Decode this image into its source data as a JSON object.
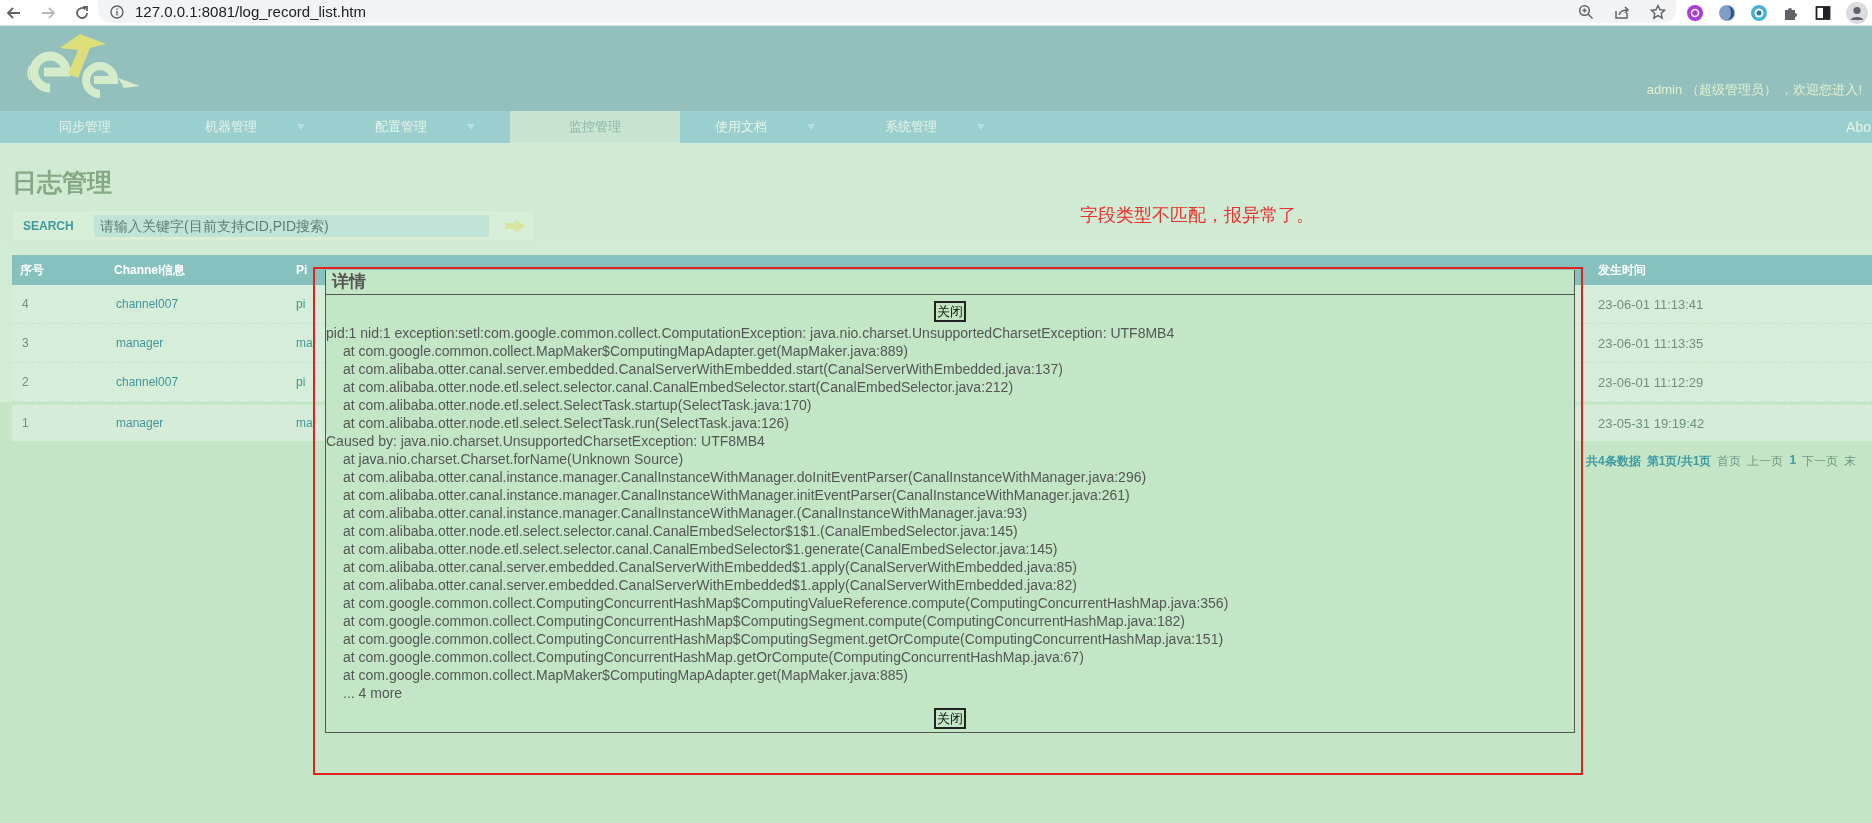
{
  "browser": {
    "url": "127.0.0.1:8081/log_record_list.htm"
  },
  "header": {
    "welcome": "admin （超级管理员） ，欢迎您进入!"
  },
  "nav": {
    "items": [
      {
        "label": "同步管理",
        "dropdown": false,
        "selected": false
      },
      {
        "label": "机器管理",
        "dropdown": true,
        "selected": false
      },
      {
        "label": "配置管理",
        "dropdown": true,
        "selected": false
      },
      {
        "label": "监控管理",
        "dropdown": false,
        "selected": true
      },
      {
        "label": "使用文档",
        "dropdown": true,
        "selected": false
      },
      {
        "label": "系统管理",
        "dropdown": true,
        "selected": false
      }
    ],
    "right_link": "Abo"
  },
  "page_title": "日志管理",
  "search": {
    "label": "SEARCH",
    "placeholder": "请输入关键字(目前支持CID,PID搜索)"
  },
  "table": {
    "columns": [
      "序号",
      "Channel信息",
      "Pi",
      "发生时间"
    ],
    "rows": [
      {
        "cells": [
          "4",
          "channel007",
          "pi",
          "23-06-01 11:13:41"
        ]
      },
      {
        "cells": [
          "3",
          "manager",
          "ma",
          "23-06-01 11:13:35"
        ]
      },
      {
        "cells": [
          "2",
          "channel007",
          "pi",
          "23-06-01 11:12:29"
        ]
      },
      {
        "cells": [
          "1",
          "manager",
          "ma",
          "23-05-31 19:19:42"
        ]
      }
    ]
  },
  "pagination": {
    "summary": "共4条数据",
    "page": "第1页/共1页",
    "first": "首页",
    "prev": "上一页",
    "current": "1",
    "next": "下一页",
    "last": "末"
  },
  "annotation": {
    "text": "字段类型不匹配，报异常了。"
  },
  "dialog": {
    "title": "详情",
    "close_top": "关闭",
    "close_bottom": "关闭",
    "lines": [
      {
        "text": "pid:1 nid:1 exception:setl:com.google.common.collect.ComputationException: java.nio.charset.UnsupportedCharsetException: UTF8MB4",
        "indent": false
      },
      {
        "text": "at com.google.common.collect.MapMaker$ComputingMapAdapter.get(MapMaker.java:889)",
        "indent": true
      },
      {
        "text": "at com.alibaba.otter.canal.server.embedded.CanalServerWithEmbedded.start(CanalServerWithEmbedded.java:137)",
        "indent": true
      },
      {
        "text": "at com.alibaba.otter.node.etl.select.selector.canal.CanalEmbedSelector.start(CanalEmbedSelector.java:212)",
        "indent": true
      },
      {
        "text": "at com.alibaba.otter.node.etl.select.SelectTask.startup(SelectTask.java:170)",
        "indent": true
      },
      {
        "text": "at com.alibaba.otter.node.etl.select.SelectTask.run(SelectTask.java:126)",
        "indent": true
      },
      {
        "text": "Caused by: java.nio.charset.UnsupportedCharsetException: UTF8MB4",
        "indent": false
      },
      {
        "text": "at java.nio.charset.Charset.forName(Unknown Source)",
        "indent": true
      },
      {
        "text": "at com.alibaba.otter.canal.instance.manager.CanalInstanceWithManager.doInitEventParser(CanalInstanceWithManager.java:296)",
        "indent": true
      },
      {
        "text": "at com.alibaba.otter.canal.instance.manager.CanalInstanceWithManager.initEventParser(CanalInstanceWithManager.java:261)",
        "indent": true
      },
      {
        "text": "at com.alibaba.otter.canal.instance.manager.CanalInstanceWithManager.(CanalInstanceWithManager.java:93)",
        "indent": true
      },
      {
        "text": "at com.alibaba.otter.node.etl.select.selector.canal.CanalEmbedSelector$1$1.(CanalEmbedSelector.java:145)",
        "indent": true
      },
      {
        "text": "at com.alibaba.otter.node.etl.select.selector.canal.CanalEmbedSelector$1.generate(CanalEmbedSelector.java:145)",
        "indent": true
      },
      {
        "text": "at com.alibaba.otter.canal.server.embedded.CanalServerWithEmbedded$1.apply(CanalServerWithEmbedded.java:85)",
        "indent": true
      },
      {
        "text": "at com.alibaba.otter.canal.server.embedded.CanalServerWithEmbedded$1.apply(CanalServerWithEmbedded.java:82)",
        "indent": true
      },
      {
        "text": "at com.google.common.collect.ComputingConcurrentHashMap$ComputingValueReference.compute(ComputingConcurrentHashMap.java:356)",
        "indent": true
      },
      {
        "text": "at com.google.common.collect.ComputingConcurrentHashMap$ComputingSegment.compute(ComputingConcurrentHashMap.java:182)",
        "indent": true
      },
      {
        "text": "at com.google.common.collect.ComputingConcurrentHashMap$ComputingSegment.getOrCompute(ComputingConcurrentHashMap.java:151)",
        "indent": true
      },
      {
        "text": "at com.google.common.collect.ComputingConcurrentHashMap.getOrCompute(ComputingConcurrentHashMap.java:67)",
        "indent": true
      },
      {
        "text": "at com.google.common.collect.MapMaker$ComputingMapAdapter.get(MapMaker.java:885)",
        "indent": true
      },
      {
        "text": "... 4 more",
        "indent": true
      }
    ]
  }
}
